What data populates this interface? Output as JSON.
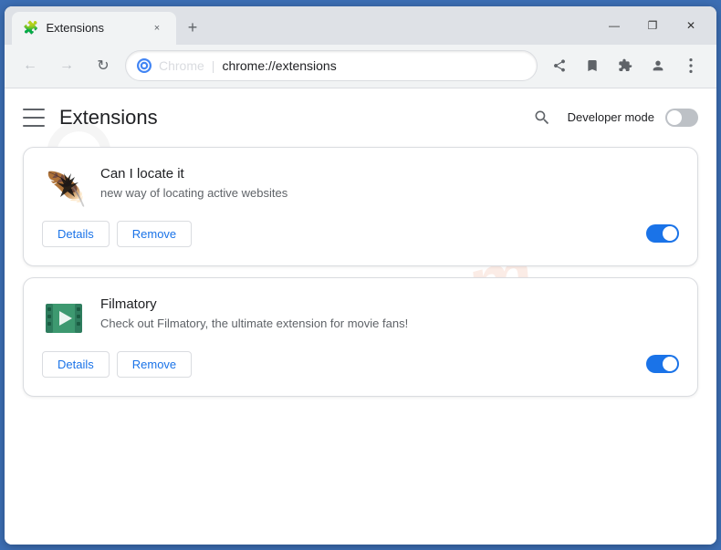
{
  "window": {
    "tab_title": "Extensions",
    "tab_close_label": "×",
    "new_tab_label": "+",
    "url_display": "Chrome",
    "url_full": "chrome://extensions",
    "win_minimize": "—",
    "win_restore": "❐",
    "win_close": "✕"
  },
  "header": {
    "page_title": "Extensions",
    "search_icon": "🔍",
    "developer_mode_label": "Developer mode",
    "developer_mode_on": false
  },
  "extensions": [
    {
      "id": "can-locate-it",
      "name": "Can I locate it",
      "description": "new way of locating active websites",
      "details_label": "Details",
      "remove_label": "Remove",
      "enabled": true
    },
    {
      "id": "filmatory",
      "name": "Filmatory",
      "description": "Check out Filmatory, the ultimate extension for movie fans!",
      "details_label": "Details",
      "remove_label": "Remove",
      "enabled": true
    }
  ]
}
